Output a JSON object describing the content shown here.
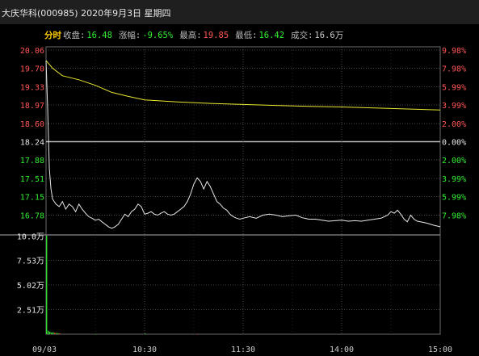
{
  "title": "大庆华科(000985) 2020年9月3日 星期四",
  "info": {
    "mode": "分时",
    "close_label": "收盘:",
    "close_value": "16.48",
    "change_label": "涨幅:",
    "change_value": "-9.65%",
    "high_label": "最高:",
    "high_value": "19.85",
    "low_label": "最低:",
    "low_value": "16.42",
    "volume_label": "成交:",
    "volume_value": "16.6万"
  },
  "colors": {
    "up": "#ff5555",
    "down": "#33ee33",
    "flat": "#e6e6e6",
    "price_line": "#e8e8e8",
    "avg_line": "#e8e830",
    "grid": "#5a5a5a",
    "volume_up": "#ff4444",
    "volume_down": "#33dd33"
  },
  "chart_data": [
    {
      "type": "line",
      "prev_close": 18.24,
      "ylim": [
        16.42,
        20.06
      ],
      "y_ticks_left": [
        "20.06",
        "19.70",
        "19.33",
        "18.97",
        "18.60",
        "18.24",
        "17.88",
        "17.51",
        "17.15",
        "16.78"
      ],
      "y_ticks_right": [
        "9.98%",
        "7.98%",
        "5.99%",
        "3.99%",
        "2.00%",
        "0.00%",
        "2.00%",
        "3.99%",
        "5.99%",
        "7.98%"
      ],
      "x_ticks": [
        "09/03",
        "10:30",
        "11:30",
        "14:00",
        "15:00"
      ],
      "minutes": 240,
      "series": [
        {
          "role": "price",
          "x": [
            0,
            1,
            2,
            3,
            4,
            6,
            8,
            10,
            12,
            14,
            16,
            18,
            20,
            22,
            24,
            26,
            28,
            30,
            32,
            34,
            36,
            38,
            40,
            42,
            44,
            46,
            48,
            50,
            52,
            54,
            56,
            58,
            60,
            62,
            64,
            66,
            68,
            70,
            72,
            74,
            76,
            78,
            80,
            82,
            84,
            86,
            88,
            90,
            92,
            94,
            96,
            98,
            100,
            102,
            104,
            106,
            108,
            110,
            112,
            114,
            116,
            118,
            120,
            124,
            128,
            132,
            136,
            140,
            144,
            148,
            152,
            156,
            160,
            164,
            168,
            172,
            176,
            180,
            184,
            188,
            192,
            196,
            200,
            204,
            208,
            210,
            212,
            214,
            216,
            218,
            220,
            222,
            224,
            226,
            228,
            232,
            236,
            240
          ],
          "y": [
            19.85,
            18.9,
            17.7,
            17.3,
            17.1,
            17.0,
            16.95,
            17.05,
            16.9,
            17.0,
            16.95,
            16.85,
            17.0,
            16.9,
            16.82,
            16.75,
            16.72,
            16.68,
            16.7,
            16.65,
            16.6,
            16.55,
            16.52,
            16.55,
            16.6,
            16.7,
            16.8,
            16.75,
            16.85,
            16.9,
            17.0,
            16.95,
            16.8,
            16.82,
            16.85,
            16.8,
            16.78,
            16.82,
            16.85,
            16.8,
            16.78,
            16.8,
            16.85,
            16.9,
            16.95,
            17.05,
            17.2,
            17.4,
            17.52,
            17.45,
            17.3,
            17.45,
            17.35,
            17.2,
            17.05,
            17.0,
            16.92,
            16.88,
            16.8,
            16.75,
            16.72,
            16.7,
            16.72,
            16.75,
            16.72,
            16.78,
            16.8,
            16.78,
            16.75,
            16.77,
            16.78,
            16.73,
            16.7,
            16.7,
            16.68,
            16.66,
            16.67,
            16.68,
            16.66,
            16.67,
            16.66,
            16.68,
            16.7,
            16.72,
            16.78,
            16.85,
            16.82,
            16.88,
            16.8,
            16.7,
            16.65,
            16.78,
            16.7,
            16.66,
            16.65,
            16.62,
            16.58,
            16.55
          ]
        },
        {
          "role": "average",
          "x": [
            0,
            4,
            10,
            20,
            30,
            40,
            50,
            60,
            80,
            100,
            120,
            140,
            160,
            180,
            200,
            220,
            240
          ],
          "y": [
            19.85,
            19.7,
            19.55,
            19.47,
            19.36,
            19.22,
            19.14,
            19.07,
            19.03,
            19.0,
            18.98,
            18.96,
            18.94,
            18.93,
            18.91,
            18.89,
            18.87
          ]
        }
      ]
    },
    {
      "type": "bar",
      "ylabel_ticks": [
        "10.0万",
        "7.53万",
        "5.02万",
        "2.51万"
      ],
      "ylim": [
        0,
        10.04
      ],
      "unit": "万",
      "bars": [
        {
          "x": 0,
          "value": 10.04,
          "dir": "down"
        },
        {
          "x": 1,
          "value": 0.35,
          "dir": "down"
        },
        {
          "x": 2,
          "value": 0.25,
          "dir": "down"
        },
        {
          "x": 3,
          "value": 0.18,
          "dir": "down"
        },
        {
          "x": 4,
          "value": 0.2,
          "dir": "down"
        },
        {
          "x": 5,
          "value": 0.15,
          "dir": "up"
        },
        {
          "x": 6,
          "value": 0.12,
          "dir": "down"
        },
        {
          "x": 7,
          "value": 0.1,
          "dir": "down"
        },
        {
          "x": 8,
          "value": 0.08,
          "dir": "up"
        },
        {
          "x": 30,
          "value": 0.03,
          "dir": "down"
        },
        {
          "x": 60,
          "value": 0.06,
          "dir": "down"
        },
        {
          "x": 92,
          "value": 0.04,
          "dir": "up"
        }
      ]
    }
  ]
}
